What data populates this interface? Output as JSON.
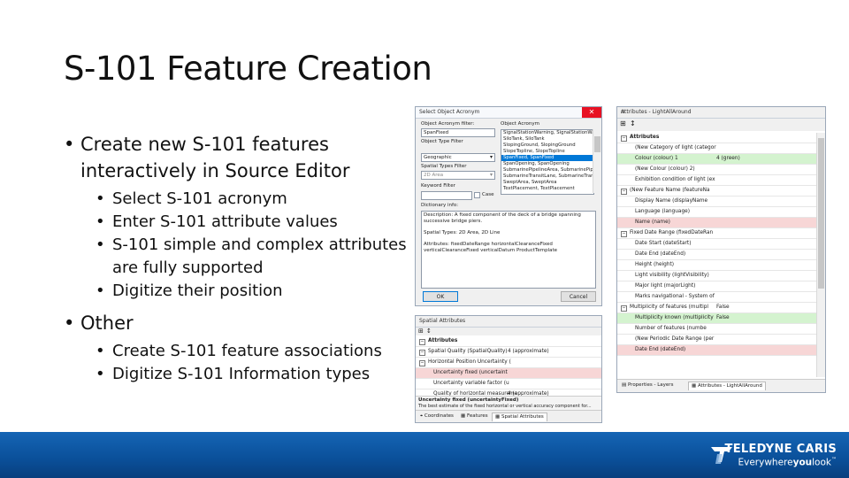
{
  "slide": {
    "title": "S-101 Feature Creation",
    "bullets": [
      {
        "text": "Create new S-101 features interactively in Source Editor",
        "sub": [
          "Select S-101 acronym",
          "Enter S-101 attribute values",
          "S-101 simple and complex attributes are fully supported",
          "Digitize their position"
        ]
      },
      {
        "text": "Other",
        "sub": [
          "Create S-101 feature associations",
          "Digitize S-101 Information types"
        ]
      }
    ]
  },
  "dialog": {
    "title": "Select Object Acronym",
    "acronym_filter_label": "Object Acronym filter:",
    "acronym_filter_value": "SpanFixed",
    "type_filter_label": "Object Type Filter",
    "type_filter_value": "Geographic",
    "spatial_filter_label": "Spatial Types Filter",
    "spatial_filter_value": "2D Area",
    "keyword_label": "Keyword Filter",
    "case_label": "Case",
    "acronym_list_label": "Object Acronym",
    "acronyms": [
      "SignalStationWarning, SignalStationWa",
      "SiloTank, SiloTank",
      "SlopingGround, SlopingGround",
      "SlopeTopline, SlopeTopline",
      "SpanFixed, SpanFixed",
      "SpanOpening, SpanOpening",
      "SubmarinePipelineArea, SubmarinePipe",
      "SubmarineTransitLane, SubmarineTrans",
      "SweptArea, SweptArea",
      "TextPlacement, TextPlacement"
    ],
    "selected_index": 4,
    "dictionary_label": "Dictionary info:",
    "description": "Description: A fixed component of the deck of a bridge spanning successive bridge piers.",
    "spatial_types": "Spatial Types: 2D Area, 2D Line",
    "attributes_info": "Attributes: fixedDateRange horizontalClearanceFixed verticalClearanceFixed verticalDatum ProductTemplate",
    "ok_label": "OK",
    "cancel_label": "Cancel"
  },
  "spatial_panel": {
    "title": "Spatial Attributes",
    "rows": [
      {
        "name": "Attributes",
        "value": "",
        "tog": "−",
        "style": "hdr"
      },
      {
        "name": "Spatial Quality (SpatialQuality)",
        "value": "4 (approximate)",
        "tog": "−",
        "style": ""
      },
      {
        "name": "Horizontal Position Uncertainty (",
        "value": "",
        "tog": "−",
        "style": ""
      },
      {
        "name": "Uncertainty fixed (uncertaint",
        "value": "",
        "tog": "",
        "style": "red"
      },
      {
        "name": "Uncertainty variable factor (u",
        "value": "",
        "tog": "",
        "style": ""
      },
      {
        "name": "Quality of horizontal measureme",
        "value": "4 (approximate)",
        "tog": "",
        "style": ""
      }
    ],
    "desc_title": "Uncertainty fixed (uncertaintyFixed)",
    "desc_text": "The best estimate of the fixed horizontal or vertical accuracy component for...",
    "tabs": [
      "Coordinates",
      "Features",
      "Spatial Attributes"
    ]
  },
  "attributes_panel": {
    "title": "Attributes - LightAllAround",
    "rows": [
      {
        "name": "Attributes",
        "value": "",
        "tog": "−",
        "style": "hdr"
      },
      {
        "name": "(New Category of light (categor",
        "value": "",
        "tog": "",
        "style": ""
      },
      {
        "name": "Colour (colour) 1",
        "value": "4 (green)",
        "tog": "",
        "style": "green"
      },
      {
        "name": "(New Colour (colour) 2)",
        "value": "",
        "tog": "",
        "style": ""
      },
      {
        "name": "Exhibition condition of light (ex",
        "value": "",
        "tog": "",
        "style": ""
      },
      {
        "name": "(New Feature Name (featureNa",
        "value": "",
        "tog": "−",
        "style": ""
      },
      {
        "name": "Display Name (displayName",
        "value": "",
        "tog": "",
        "style": ""
      },
      {
        "name": "Language (language)",
        "value": "",
        "tog": "",
        "style": ""
      },
      {
        "name": "Name (name)",
        "value": "",
        "tog": "",
        "style": "red"
      },
      {
        "name": "Fixed Date Range (fixedDateRan",
        "value": "",
        "tog": "−",
        "style": ""
      },
      {
        "name": "Date Start (dateStart)",
        "value": "",
        "tog": "",
        "style": ""
      },
      {
        "name": "Date End (dateEnd)",
        "value": "",
        "tog": "",
        "style": ""
      },
      {
        "name": "Height (height)",
        "value": "",
        "tog": "",
        "style": ""
      },
      {
        "name": "Light visibility (lightVisibility)",
        "value": "",
        "tog": "",
        "style": ""
      },
      {
        "name": "Major light (majorLight)",
        "value": "",
        "tog": "",
        "style": ""
      },
      {
        "name": "Marks navigational - System of",
        "value": "",
        "tog": "",
        "style": ""
      },
      {
        "name": "Multiplicity of features (multipl",
        "value": "False",
        "tog": "−",
        "style": ""
      },
      {
        "name": "Multiplicity known (multiplicity",
        "value": "False",
        "tog": "",
        "style": "green"
      },
      {
        "name": "Number of features (numbe",
        "value": "",
        "tog": "",
        "style": ""
      },
      {
        "name": "(New Periodic Date Range (per",
        "value": "",
        "tog": "",
        "style": ""
      },
      {
        "name": "Date End (dateEnd)",
        "value": "",
        "tog": "",
        "style": "red"
      }
    ],
    "tabs": [
      "Properties - Layers",
      "Attributes - LightAllAround"
    ]
  },
  "brand": {
    "name": "TELEDYNE CARIS",
    "tagline_pre": "Everywhere",
    "tagline_bold": "you",
    "tagline_post": "look",
    "tm": "™",
    "footer_color": "#0a4f99"
  }
}
